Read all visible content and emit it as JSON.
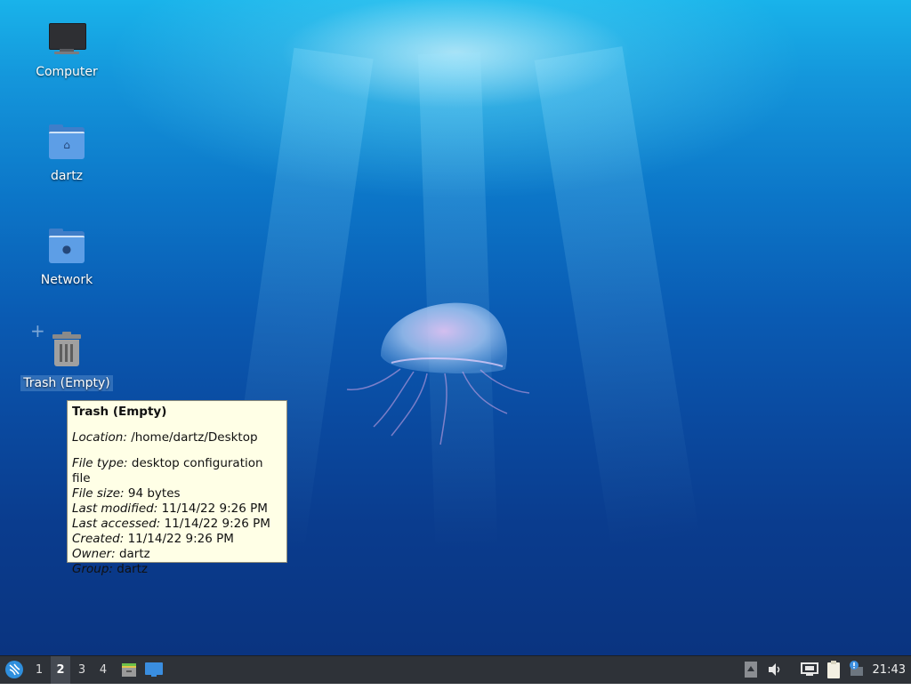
{
  "desktop": {
    "icons": [
      {
        "label": "Computer"
      },
      {
        "label": "dartz"
      },
      {
        "label": "Network"
      },
      {
        "label": "Trash (Empty)"
      }
    ]
  },
  "tooltip": {
    "title": "Trash (Empty)",
    "location_label": "Location:",
    "location_value": "/home/dartz/Desktop",
    "file_type_label": "File type:",
    "file_type_value": "desktop configuration file",
    "file_size_label": "File size:",
    "file_size_value": "94 bytes",
    "last_modified_label": "Last modified:",
    "last_modified_value": "11/14/22 9:26 PM",
    "last_accessed_label": "Last accessed:",
    "last_accessed_value": "11/14/22 9:26 PM",
    "created_label": "Created:",
    "created_value": "11/14/22 9:26 PM",
    "owner_label": "Owner:",
    "owner_value": "dartz",
    "group_label": "Group:",
    "group_value": "dartz"
  },
  "taskbar": {
    "workspaces": [
      "1",
      "2",
      "3",
      "4"
    ],
    "active_workspace": "2",
    "clock": "21:43",
    "icons": {
      "menu": "start-menu-icon",
      "file_manager": "file-manager-icon",
      "show_desktop": "show-desktop-icon",
      "tray_up": "tray-up-arrow-icon",
      "volume": "volume-icon",
      "network": "network-icon",
      "clipboard": "clipboard-icon",
      "updates": "update-notifier-icon"
    }
  },
  "colors": {
    "taskbar_bg": "#2e3238",
    "tooltip_bg": "#ffffe6",
    "folder_blue": "#5d9ee6"
  }
}
